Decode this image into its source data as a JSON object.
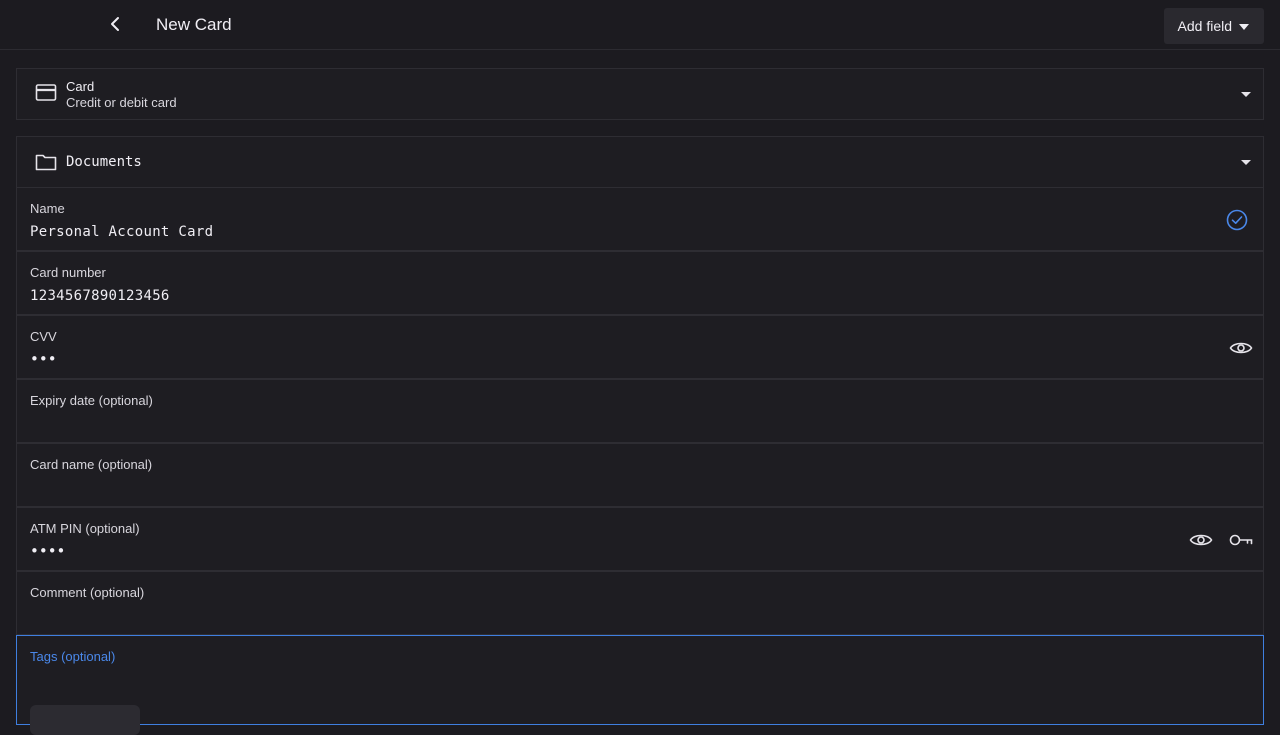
{
  "header": {
    "title": "New Card",
    "add_field_label": "Add field"
  },
  "type_selector": {
    "name": "Card",
    "description": "Credit or debit card"
  },
  "folder_selector": {
    "name": "Documents"
  },
  "fields": {
    "name": {
      "label": "Name",
      "value": "Personal Account Card"
    },
    "card_number": {
      "label": "Card number",
      "value": "1234567890123456"
    },
    "cvv": {
      "label": "CVV",
      "value": "•••"
    },
    "expiry": {
      "label": "Expiry date (optional)",
      "value": ""
    },
    "card_name": {
      "label": "Card name (optional)",
      "value": ""
    },
    "atm_pin": {
      "label": "ATM PIN (optional)",
      "value": "••••"
    },
    "comment": {
      "label": "Comment (optional)",
      "value": ""
    },
    "tags": {
      "label": "Tags (optional)"
    }
  },
  "colors": {
    "background": "#1c1b20",
    "panel": "#1e1d22",
    "accent": "#3f7fe0",
    "text": "#f0eef4"
  },
  "icons": {
    "back": "chevron-left-icon",
    "type": "credit-card-icon",
    "folder": "folder-icon",
    "name_status": "check-circle-icon",
    "reveal": "eye-icon",
    "generate": "key-icon"
  }
}
